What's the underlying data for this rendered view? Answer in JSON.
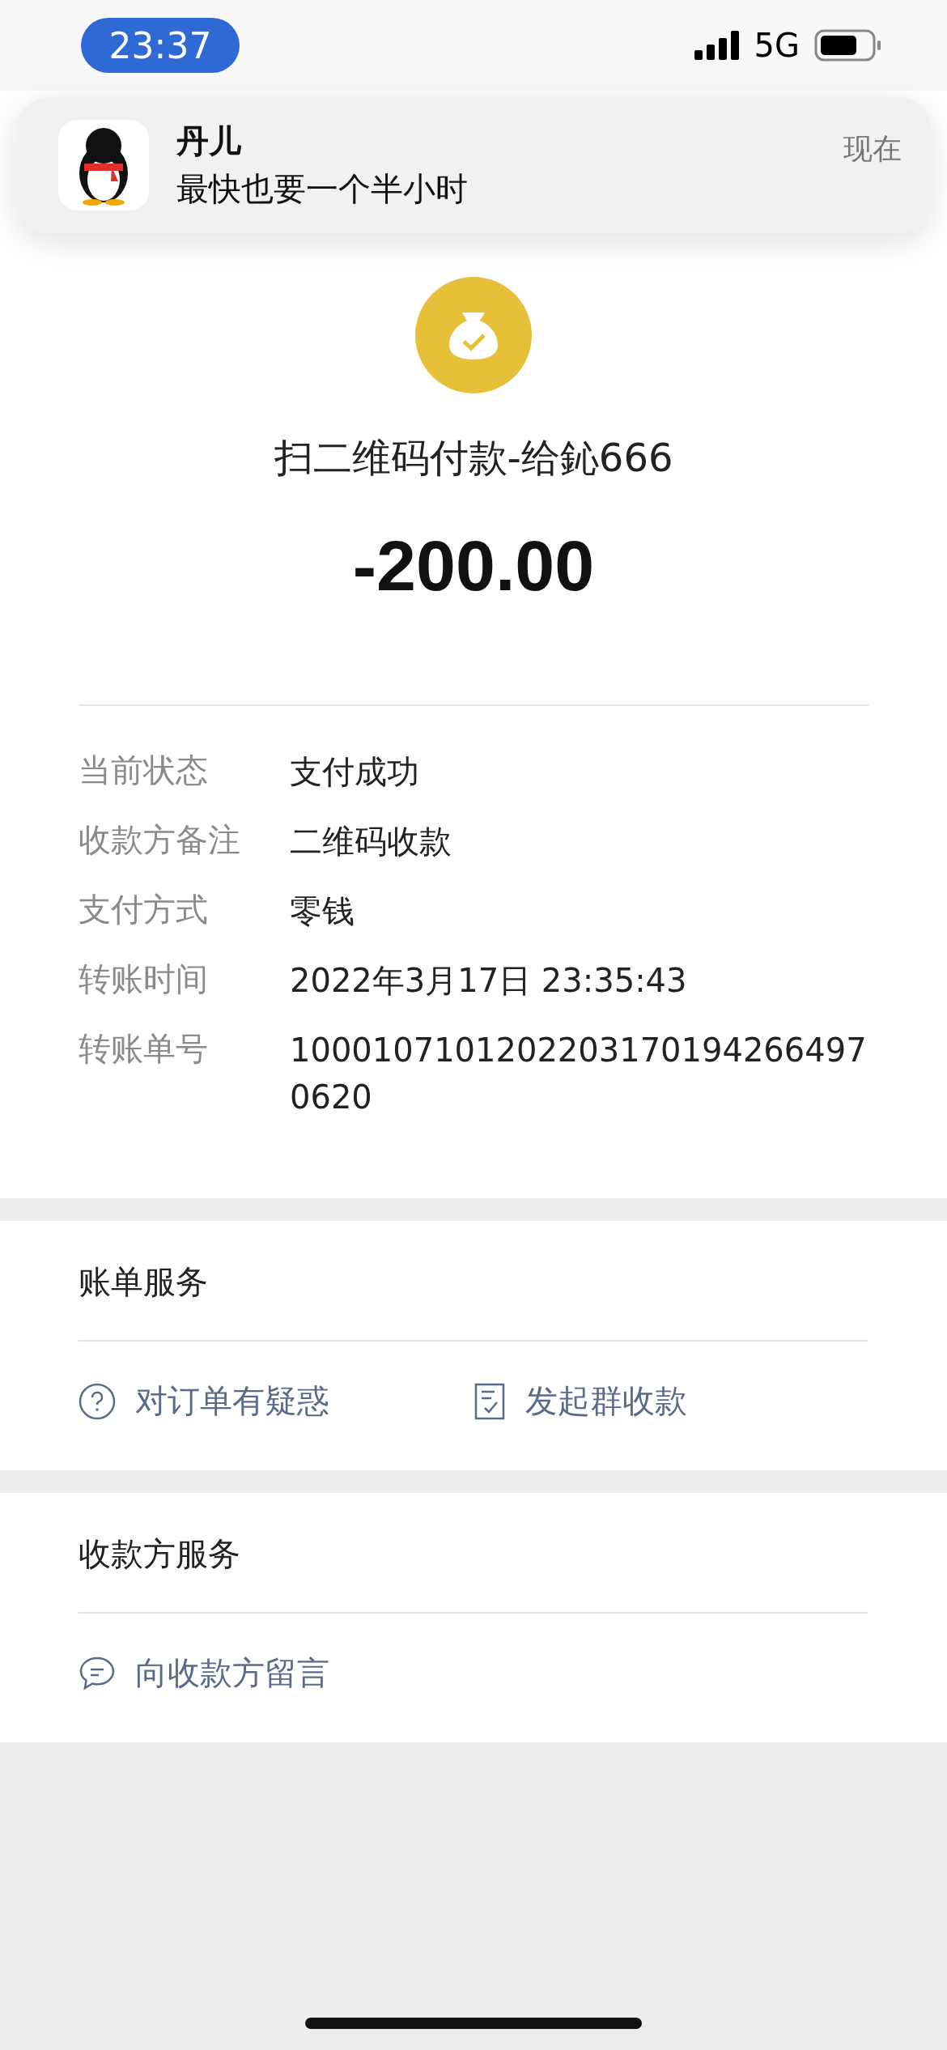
{
  "status_bar": {
    "time": "23:37",
    "network": "5G"
  },
  "notification": {
    "sender": "丹儿",
    "message": "最快也要一个半小时",
    "time": "现在"
  },
  "payment": {
    "title": "扫二维码付款-给鈊666",
    "amount": "-200.00"
  },
  "details": [
    {
      "label": "当前状态",
      "value": "支付成功"
    },
    {
      "label": "收款方备注",
      "value": "二维码收款"
    },
    {
      "label": "支付方式",
      "value": "零钱"
    },
    {
      "label": "转账时间",
      "value": "2022年3月17日 23:35:43"
    },
    {
      "label": "转账单号",
      "value": "10001071012022031701942664970620"
    }
  ],
  "sections": [
    {
      "title": "账单服务",
      "actions": [
        {
          "kind": "question",
          "label": "对订单有疑惑"
        },
        {
          "kind": "checklist",
          "label": "发起群收款"
        }
      ]
    },
    {
      "title": "收款方服务",
      "actions": [
        {
          "kind": "message",
          "label": "向收款方留言"
        }
      ]
    }
  ]
}
